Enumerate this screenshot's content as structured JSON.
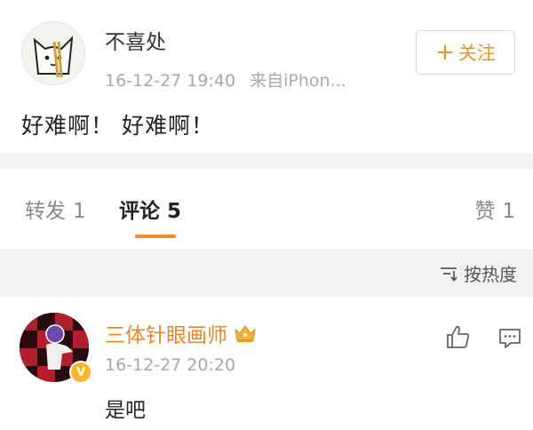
{
  "post": {
    "author": "不喜处",
    "timestamp": "16-12-27 19:40",
    "source": "来自iPhon...",
    "text": "好难啊！ 好难啊！",
    "follow_plus": "+",
    "follow_label": "关注",
    "avatar_icon": "cat-holding-chopsticks-avatar"
  },
  "tabs": {
    "repost_label": "转发",
    "repost_count": "1",
    "comment_label": "评论",
    "comment_count": "5",
    "like_label": "赞",
    "like_count": "1",
    "active": "comment"
  },
  "sort": {
    "label": "按热度",
    "icon": "sort-icon"
  },
  "comments": [
    {
      "author": "三体针眼画师",
      "timestamp": "16-12-27 20:20",
      "text": "是吧",
      "badge_icon": "verified-v-badge-icon",
      "member_icon": "crown-badge-icon"
    }
  ],
  "colors": {
    "accent": "#e8912d",
    "username": "#e8862a",
    "tab_indicator": "#f08a2c",
    "divider_gray": "#f2f2f2",
    "meta_gray": "#a8a8a8"
  }
}
